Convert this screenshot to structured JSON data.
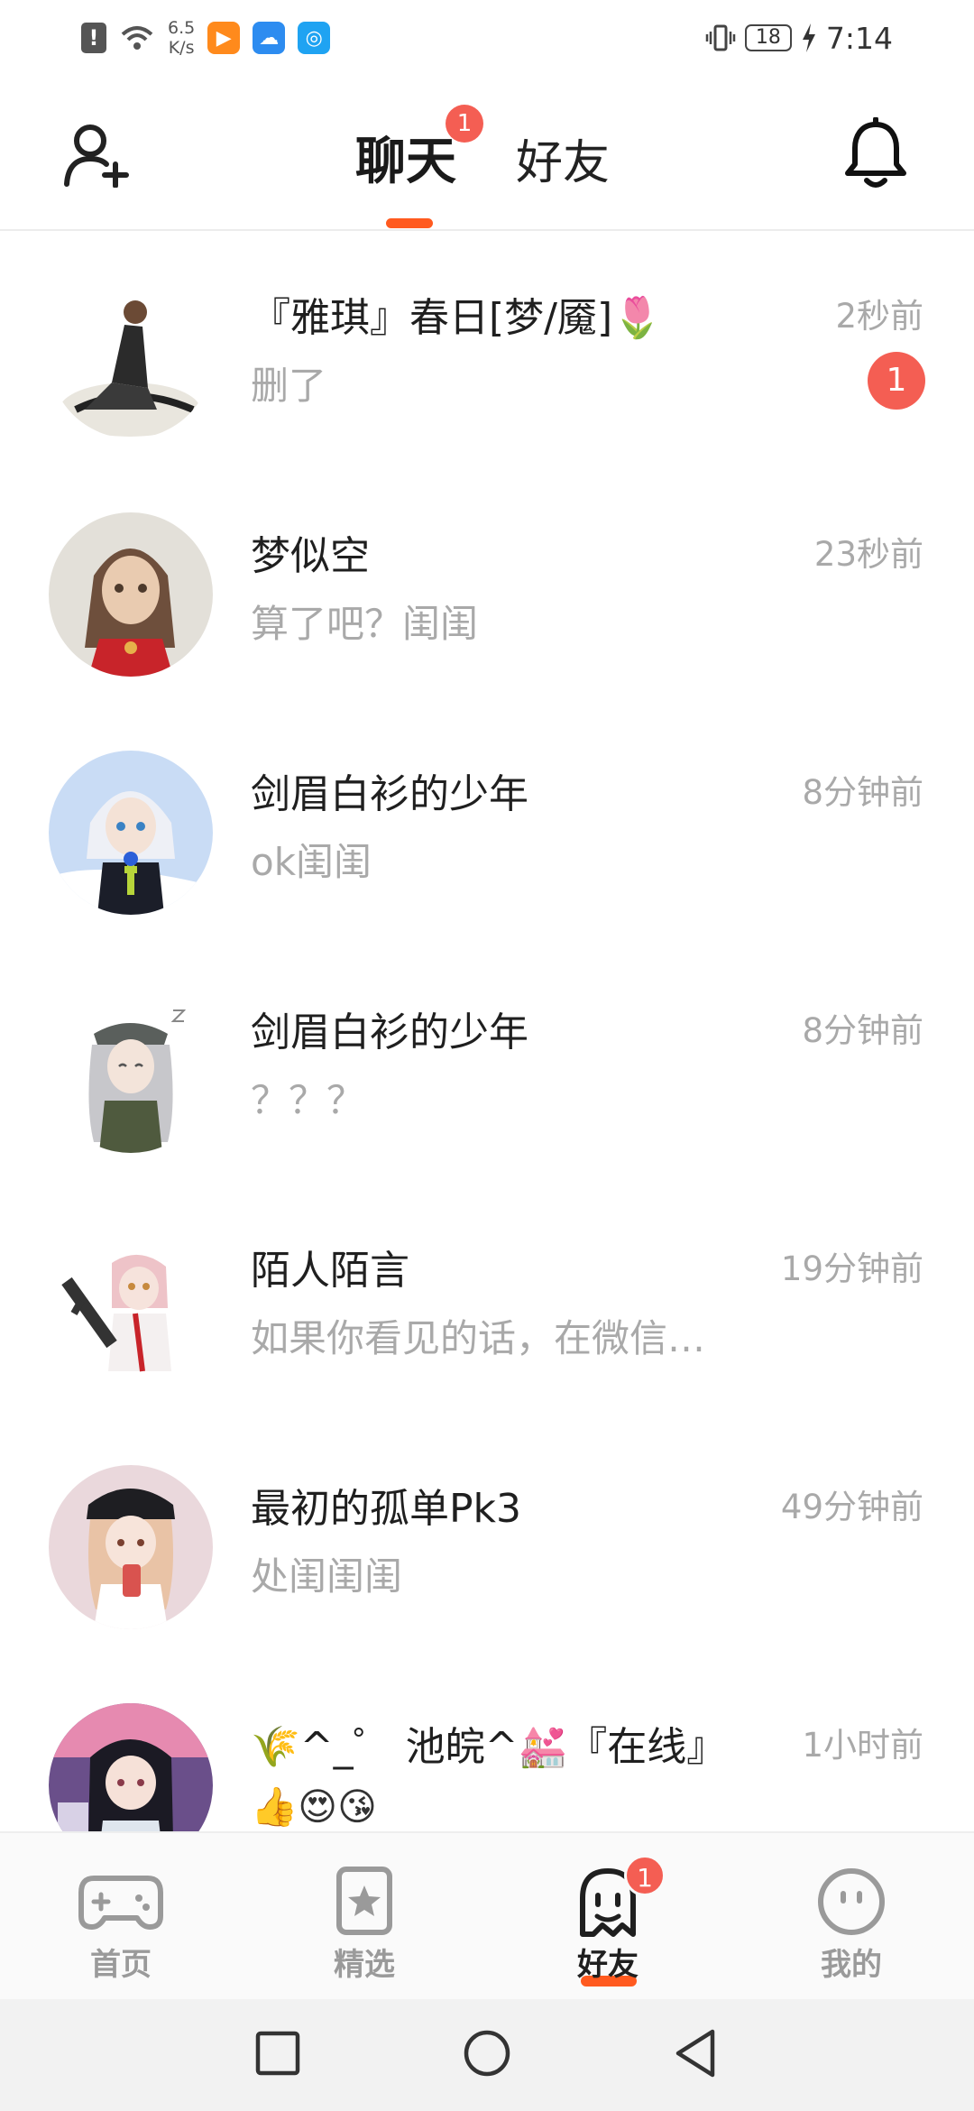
{
  "status_bar": {
    "speed_value": "6.5",
    "speed_unit": "K/s",
    "battery": "18",
    "time": "7:14",
    "icons": [
      "alert-icon",
      "wifi-icon",
      "video-app-icon",
      "weather-app-icon",
      "browser-app-icon",
      "vibrate-icon",
      "charging-icon"
    ]
  },
  "header": {
    "tabs": [
      {
        "label": "聊天",
        "active": true,
        "badge": "1"
      },
      {
        "label": "好友",
        "active": false
      }
    ],
    "accent_color": "#ff5a1f",
    "badge_color": "#f45e53"
  },
  "chats": [
    {
      "name": "『雅琪』春日[梦/魇]🌷",
      "message": "删了",
      "time": "2秒前",
      "unread": "1"
    },
    {
      "name": "梦似空",
      "message": "算了吧？闺闺",
      "time": "23秒前"
    },
    {
      "name": "剑眉白衫的少年",
      "message": "ok闺闺",
      "time": "8分钟前"
    },
    {
      "name": "剑眉白衫的少年",
      "message": "？？？",
      "time": "8分钟前"
    },
    {
      "name": "陌人陌言",
      "message": "如果你看见的话，在微信…",
      "time": "19分钟前"
    },
    {
      "name": "最初的孤单Pk3",
      "message": "处闺闺闺",
      "time": "49分钟前"
    },
    {
      "name": "🌾^_゜ 池皖^💒『在线』",
      "message": "👍😍😘",
      "time": "1小时前"
    }
  ],
  "bottom_nav": {
    "items": [
      {
        "label": "首页",
        "icon": "gamepad-icon"
      },
      {
        "label": "精选",
        "icon": "star-bookmark-icon"
      },
      {
        "label": "好友",
        "icon": "ghost-icon",
        "active": true,
        "badge": "1"
      },
      {
        "label": "我的",
        "icon": "smiley-icon"
      }
    ]
  }
}
